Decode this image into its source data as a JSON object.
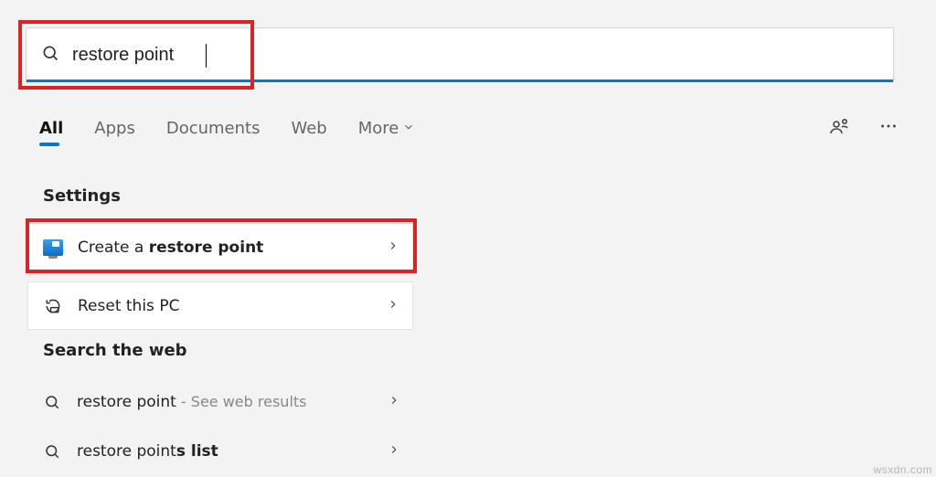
{
  "search": {
    "value": "restore point"
  },
  "tabs": {
    "items": [
      {
        "label": "All",
        "active": true,
        "icon": null
      },
      {
        "label": "Apps",
        "active": false,
        "icon": null
      },
      {
        "label": "Documents",
        "active": false,
        "icon": null
      },
      {
        "label": "Web",
        "active": false,
        "icon": null
      },
      {
        "label": "More",
        "active": false,
        "icon": "chevron-down"
      }
    ]
  },
  "sections": {
    "settings": {
      "heading": "Settings",
      "items": [
        {
          "prefix": "Create a ",
          "match": "restore point",
          "suffix": "",
          "icon": "monitor"
        },
        {
          "prefix": "Reset this PC",
          "match": "",
          "suffix": "",
          "icon": "reset"
        }
      ]
    },
    "web": {
      "heading": "Search the web",
      "items": [
        {
          "prefix": "restore point",
          "sub": " - See web results",
          "icon": "search"
        },
        {
          "prefix": "restore point",
          "match": "s list",
          "icon": "search"
        }
      ]
    }
  },
  "watermark": "wsxdn.com"
}
